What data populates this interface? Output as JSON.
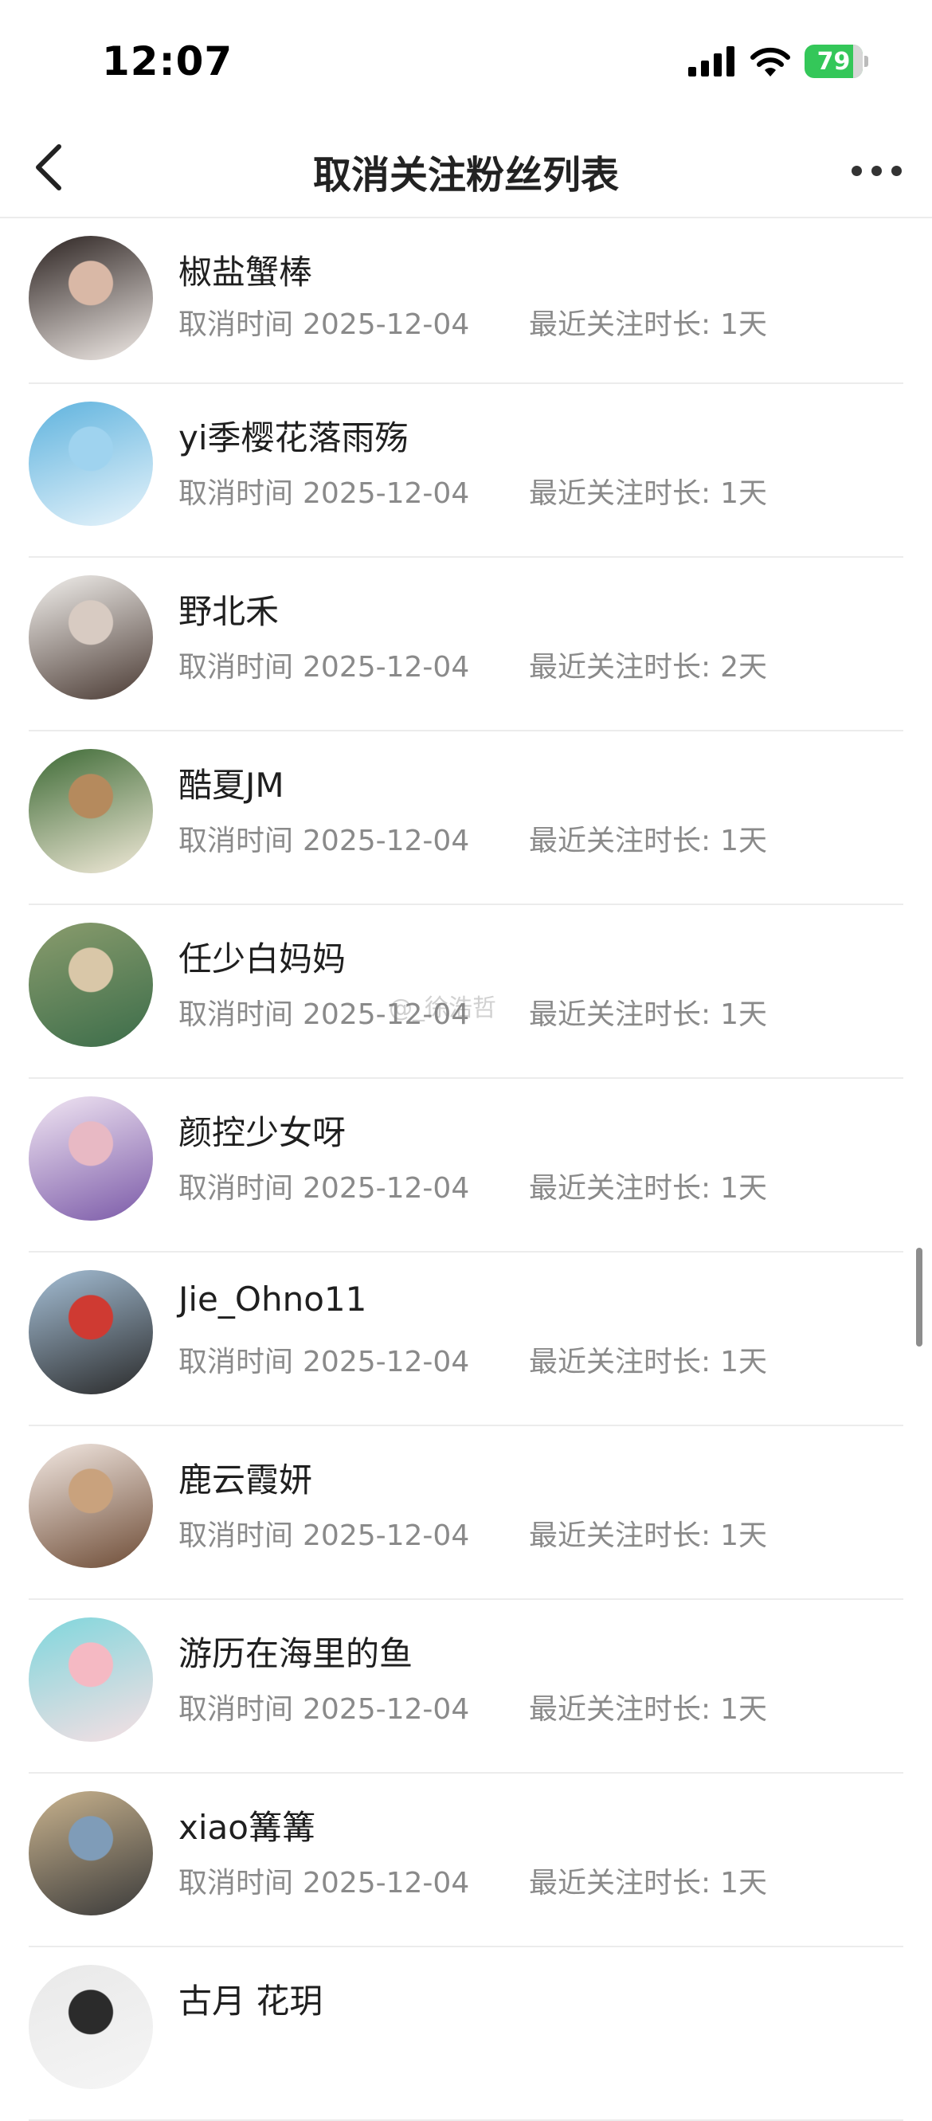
{
  "status_bar": {
    "time": "12:07",
    "battery": "79"
  },
  "nav": {
    "title": "取消关注粉丝列表"
  },
  "row_labels": {
    "cancel_time": "取消时间",
    "duration": "最近关注时长:"
  },
  "rows": [
    {
      "name": "椒盐蟹棒",
      "date": "2025-12-04",
      "duration": "1天",
      "avatar_colors": [
        "#2b2220",
        "#d9b8a6",
        "#f2ece8"
      ]
    },
    {
      "name": "yi季樱花落雨殇",
      "date": "2025-12-04",
      "duration": "1天",
      "avatar_colors": [
        "#5fb3de",
        "#9fd3ef",
        "#e8f4fb"
      ]
    },
    {
      "name": "野北禾",
      "date": "2025-12-04",
      "duration": "2天",
      "avatar_colors": [
        "#f3f1ee",
        "#d8cbc2",
        "#4a3a33"
      ]
    },
    {
      "name": "酷夏JM",
      "date": "2025-12-04",
      "duration": "1天",
      "avatar_colors": [
        "#3d6a35",
        "#b58a5d",
        "#f2ead9"
      ]
    },
    {
      "name": "任少白妈妈",
      "date": "2025-12-04",
      "duration": "1天",
      "avatar_colors": [
        "#8a9c6d",
        "#d9c7a8",
        "#3c6d4a"
      ]
    },
    {
      "name": "颜控少女呀",
      "date": "2025-12-04",
      "duration": "1天",
      "avatar_colors": [
        "#f1e6f3",
        "#e8b9c4",
        "#7b5aa8"
      ]
    },
    {
      "name": "Jie_Ohno11",
      "date": "2025-12-04",
      "duration": "1天",
      "avatar_colors": [
        "#a5bfd6",
        "#cf3a32",
        "#2a2a2a"
      ]
    },
    {
      "name": "鹿云霞妍",
      "date": "2025-12-04",
      "duration": "1天",
      "avatar_colors": [
        "#f3e9e3",
        "#c9a27d",
        "#6e4c36"
      ]
    },
    {
      "name": "游历在海里的鱼",
      "date": "2025-12-04",
      "duration": "1天",
      "avatar_colors": [
        "#7fd6dc",
        "#f5b9c3",
        "#f7dfe3"
      ]
    },
    {
      "name": "xiao篝篝",
      "date": "2025-12-04",
      "duration": "1天",
      "avatar_colors": [
        "#c9b38e",
        "#7f9cb8",
        "#3a3a3a"
      ]
    },
    {
      "name": "古月 花玥",
      "date": "",
      "duration": "",
      "avatar_colors": [
        "#e9e9e9",
        "#2b2b2b",
        "#f5f5f5"
      ]
    }
  ],
  "watermark": "@_徐浩哲"
}
